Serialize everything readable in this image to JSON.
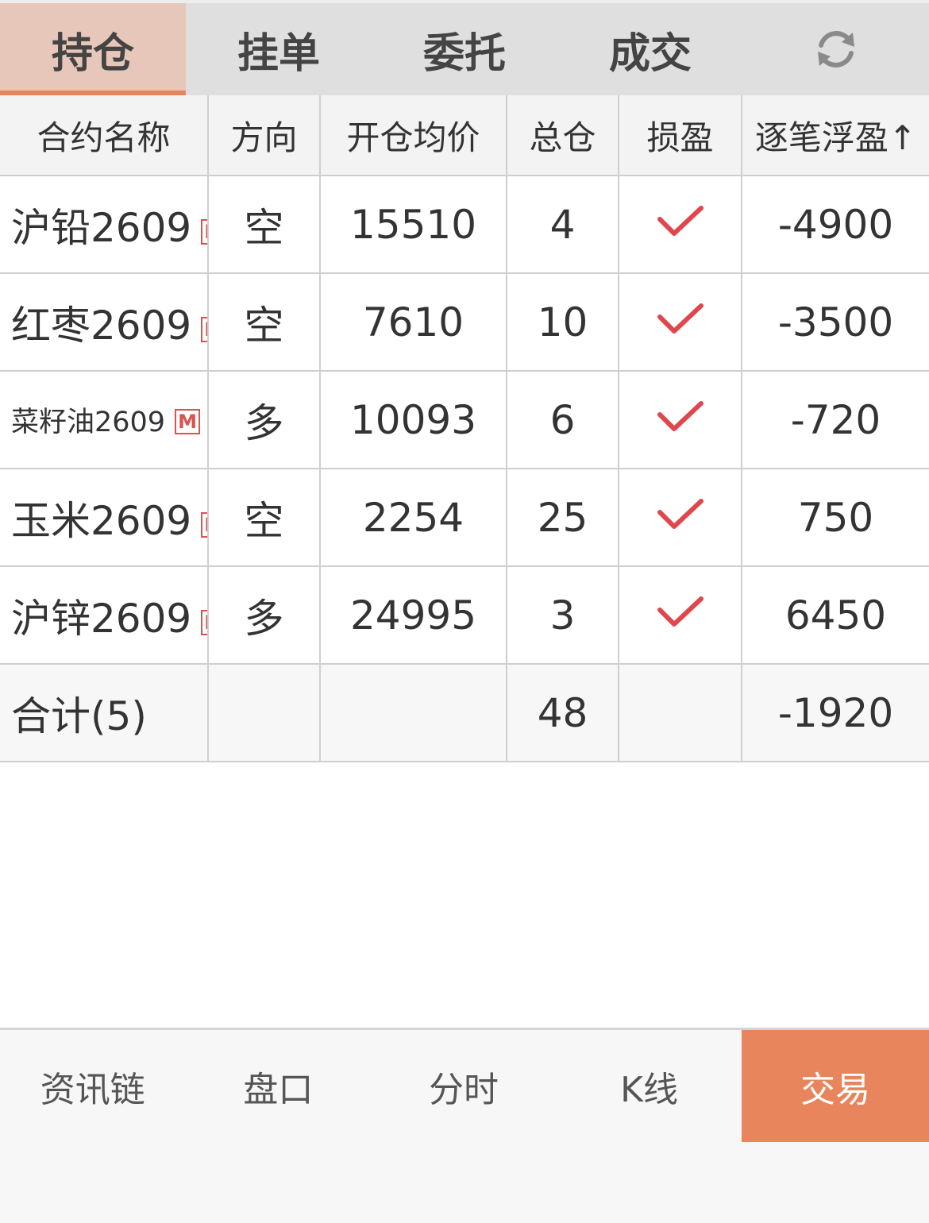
{
  "tabs": [
    {
      "label": "持仓",
      "active": true
    },
    {
      "label": "挂单",
      "active": false
    },
    {
      "label": "委托",
      "active": false
    },
    {
      "label": "成交",
      "active": false
    }
  ],
  "refresh_icon": "refresh-icon",
  "table": {
    "headers": [
      "合约名称",
      "方向",
      "开仓均价",
      "总仓",
      "损盈",
      "逐笔浮盈↑"
    ],
    "rows": [
      {
        "name": "沪铅2609",
        "badge": "M",
        "direction": "空",
        "avg_price": "15510",
        "total": "4",
        "pl_set": "check-icon",
        "float_pnl": "-4900"
      },
      {
        "name": "红枣2609",
        "badge": "M",
        "direction": "空",
        "avg_price": "7610",
        "total": "10",
        "pl_set": "check-icon",
        "float_pnl": "-3500"
      },
      {
        "name": "菜籽油2609",
        "badge": "M",
        "direction": "多",
        "avg_price": "10093",
        "total": "6",
        "pl_set": "check-icon",
        "float_pnl": "-720"
      },
      {
        "name": "玉米2609",
        "badge": "M",
        "direction": "空",
        "avg_price": "2254",
        "total": "25",
        "pl_set": "check-icon",
        "float_pnl": "750"
      },
      {
        "name": "沪锌2609",
        "badge": "M",
        "direction": "多",
        "avg_price": "24995",
        "total": "3",
        "pl_set": "check-icon",
        "float_pnl": "6450"
      }
    ],
    "summary": {
      "label": "合计(5)",
      "total": "48",
      "float_pnl": "-1920"
    }
  },
  "bottom_nav": [
    {
      "label": "资讯链",
      "active": false
    },
    {
      "label": "盘口",
      "active": false
    },
    {
      "label": "分时",
      "active": false
    },
    {
      "label": "K线",
      "active": false
    },
    {
      "label": "交易",
      "active": true
    }
  ],
  "colors": {
    "accent": "#e9855c",
    "active_tab_bg": "#e7c7b9",
    "short_green": "#3f8a5a",
    "long_red": "#d85656",
    "check_red": "#e0474c"
  }
}
